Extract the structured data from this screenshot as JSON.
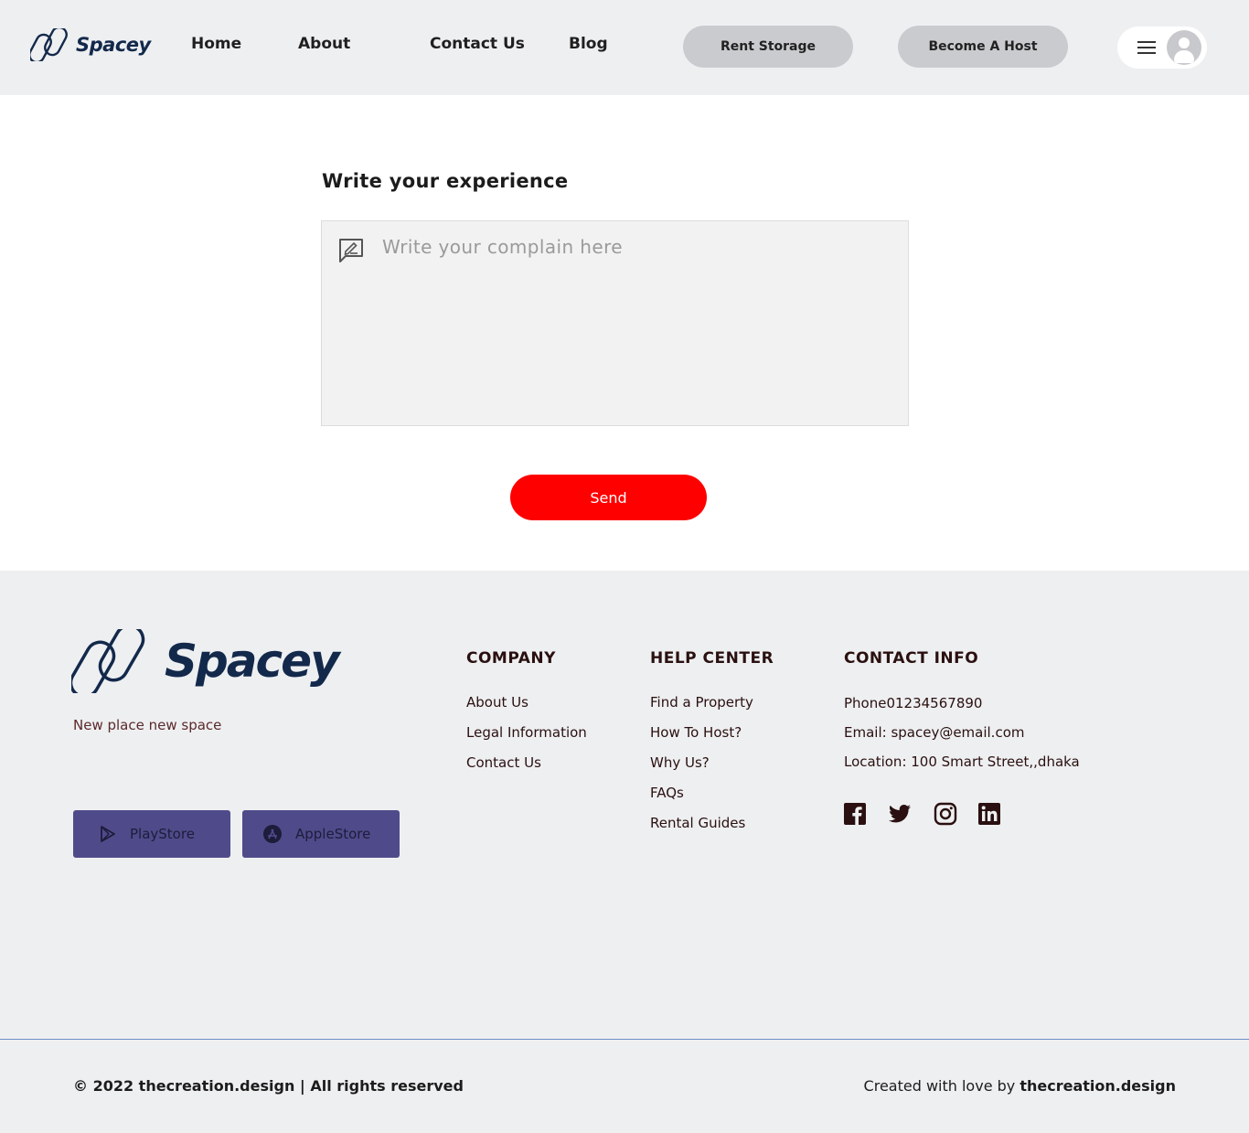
{
  "header": {
    "brand": "Spacey",
    "nav": [
      "Home",
      "About",
      "Contact Us",
      "Blog"
    ],
    "rent_storage": "Rent Storage",
    "become_host": "Become A Host"
  },
  "main": {
    "title": "Write your experience",
    "complaint_placeholder": "Write your complain here",
    "send_label": "Send"
  },
  "footer": {
    "brand": "Spacey",
    "tagline": "New place new  space",
    "playstore": "PlayStore",
    "applestore": "AppleStore",
    "company": {
      "title": "COMPANY",
      "links": [
        "About Us",
        "Legal Information",
        "Contact Us"
      ]
    },
    "help_center": {
      "title": "HELP CENTER",
      "links": [
        "Find a Property",
        "How To Host?",
        "Why Us?",
        "FAQs",
        "Rental Guides"
      ]
    },
    "contact_info": {
      "title": "CONTACT INFO",
      "phone": "Phone01234567890",
      "email": "Email: spacey@email.com",
      "location": "Location: 100 Smart Street,,dhaka"
    },
    "social_icons": [
      "facebook-icon",
      "twitter-icon",
      "instagram-icon",
      "linkedin-icon"
    ],
    "copyright": "© 2022 thecreation.design | All rights reserved",
    "credit_prefix": "Created with love by ",
    "credit_brand": "thecreation.design"
  },
  "colors": {
    "brand_navy": "#13294b",
    "send_red": "#ff0000",
    "store_purple": "#4f4b8a",
    "pill_gray": "#c9cbcf",
    "bg_gray": "#eeeff1"
  }
}
